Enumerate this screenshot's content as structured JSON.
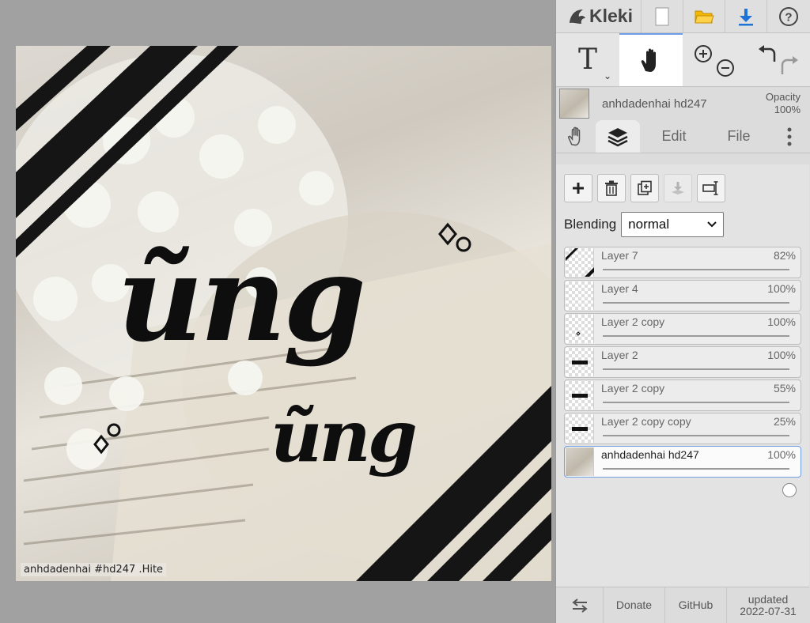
{
  "app": {
    "name": "Kleki"
  },
  "canvas": {
    "headline_text": "ũng",
    "sub_text": "ũng",
    "watermark": "anhdadenhai #hd247 .Hite"
  },
  "toolbar": {
    "tools": [
      {
        "name": "text-tool",
        "glyph": "T"
      },
      {
        "name": "hand-tool",
        "glyph": "hand"
      },
      {
        "name": "zoom-tool",
        "glyph": "zoom"
      },
      {
        "name": "undo-redo",
        "glyph": "undo"
      }
    ]
  },
  "current_layer": {
    "name": "anhdadenhai hd247",
    "opacity_label": "Opacity",
    "opacity_value": "100%"
  },
  "tabs": [
    {
      "label": "",
      "icon": "hand-icon"
    },
    {
      "label": "",
      "icon": "layers-icon"
    },
    {
      "label": "Edit"
    },
    {
      "label": "File"
    },
    {
      "label": "",
      "icon": "more-icon"
    }
  ],
  "blending": {
    "label": "Blending",
    "value": "normal"
  },
  "layers": [
    {
      "name": "Layer 7",
      "opacity": "82%",
      "level": 0.82
    },
    {
      "name": "Layer 4",
      "opacity": "100%",
      "level": 1.0
    },
    {
      "name": "Layer 2 copy",
      "opacity": "100%",
      "level": 1.0
    },
    {
      "name": "Layer 2",
      "opacity": "100%",
      "level": 1.0
    },
    {
      "name": "Layer 2 copy",
      "opacity": "55%",
      "level": 0.55
    },
    {
      "name": "Layer 2 copy copy",
      "opacity": "25%",
      "level": 0.25
    },
    {
      "name": "anhdadenhai hd247",
      "opacity": "100%",
      "level": 1.0
    }
  ],
  "footer": {
    "donate": "Donate",
    "github": "GitHub",
    "updated_label": "updated",
    "updated_date": "2022-07-31"
  },
  "colors": {
    "accent": "#6d9ee6",
    "download": "#1e74d6",
    "folder": "#f2b705"
  }
}
